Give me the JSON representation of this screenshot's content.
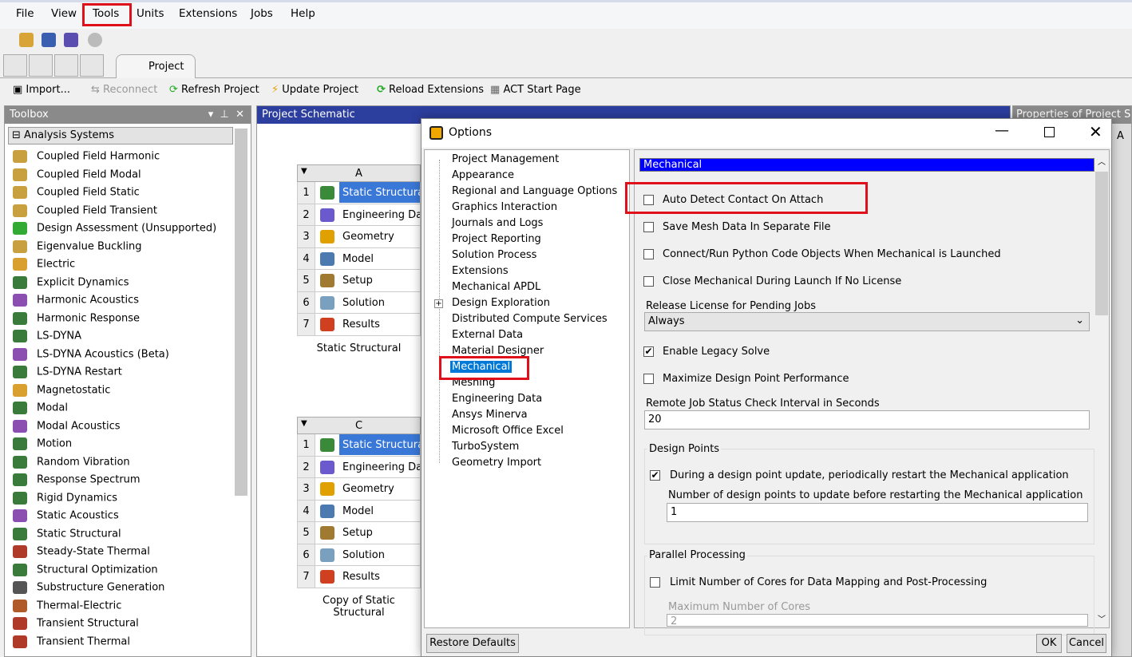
{
  "menu": [
    "File",
    "View",
    "Tools",
    "Units",
    "Extensions",
    "Jobs",
    "Help"
  ],
  "tab": "Project",
  "toolbar": {
    "import": "Import...",
    "reconnect": "Reconnect",
    "refresh": "Refresh Project",
    "update": "Update Project",
    "reload": "Reload Extensions",
    "act": "ACT Start Page"
  },
  "toolbox": {
    "title": "Toolbox",
    "section": "Analysis Systems",
    "items": [
      "Coupled Field Harmonic",
      "Coupled Field Modal",
      "Coupled Field Static",
      "Coupled Field Transient",
      "Design Assessment (Unsupported)",
      "Eigenvalue Buckling",
      "Electric",
      "Explicit Dynamics",
      "Harmonic Acoustics",
      "Harmonic Response",
      "LS-DYNA",
      "LS-DYNA Acoustics (Beta)",
      "LS-DYNA Restart",
      "Magnetostatic",
      "Modal",
      "Modal Acoustics",
      "Motion",
      "Random Vibration",
      "Response Spectrum",
      "Rigid Dynamics",
      "Static Acoustics",
      "Static Structural",
      "Steady-State Thermal",
      "Structural Optimization",
      "Substructure Generation",
      "Thermal-Electric",
      "Transient Structural",
      "Transient Thermal"
    ]
  },
  "schematic": {
    "title": "Project Schematic",
    "systems": [
      {
        "col": "A",
        "caption": "Static Structural",
        "rows": [
          "Static Structural",
          "Engineering Data",
          "Geometry",
          "Model",
          "Setup",
          "Solution",
          "Results"
        ]
      },
      {
        "col": "C",
        "caption": "Copy of Static Structural",
        "rows": [
          "Static Structural",
          "Engineering Data",
          "Geometry",
          "Model",
          "Setup",
          "Solution",
          "Results"
        ]
      }
    ]
  },
  "properties": {
    "title": "Properties of Project Schematic",
    "col": "A"
  },
  "dialog": {
    "title": "Options",
    "tree": [
      "Project Management",
      "Appearance",
      "Regional and Language Options",
      "Graphics Interaction",
      "Journals and Logs",
      "Project Reporting",
      "Solution Process",
      "Extensions",
      "Mechanical APDL",
      "Design Exploration",
      "Distributed Compute Services",
      "External Data",
      "Material Designer",
      "Mechanical",
      "Meshing",
      "Engineering Data",
      "Ansys Minerva",
      "Microsoft Office Excel",
      "TurboSystem",
      "Geometry Import"
    ],
    "selected": "Mechanical",
    "header": "Mechanical",
    "opts": [
      {
        "label": "Auto Detect Contact On Attach",
        "checked": false
      },
      {
        "label": "Save Mesh Data In Separate File",
        "checked": false
      },
      {
        "label": "Connect/Run Python Code Objects When Mechanical is Launched",
        "checked": false
      },
      {
        "label": "Close Mechanical During Launch If No License",
        "checked": false
      }
    ],
    "release_label": "Release License for Pending Jobs",
    "release_value": "Always",
    "legacy": "Enable Legacy Solve",
    "maximize": "Maximize Design Point Performance",
    "remote_label": "Remote Job Status Check Interval in Seconds",
    "remote_value": "20",
    "dp_group": "Design Points",
    "dp_restart": "During a design point update, periodically restart the Mechanical application",
    "dp_num_label": "Number of design points to update before restarting the Mechanical application",
    "dp_num_value": "1",
    "pp_group": "Parallel Processing",
    "pp_limit": "Limit Number of Cores for Data Mapping and Post-Processing",
    "pp_max_label": "Maximum Number of Cores",
    "pp_max_value": "2",
    "restore": "Restore Defaults",
    "ok": "OK",
    "cancel": "Cancel"
  }
}
